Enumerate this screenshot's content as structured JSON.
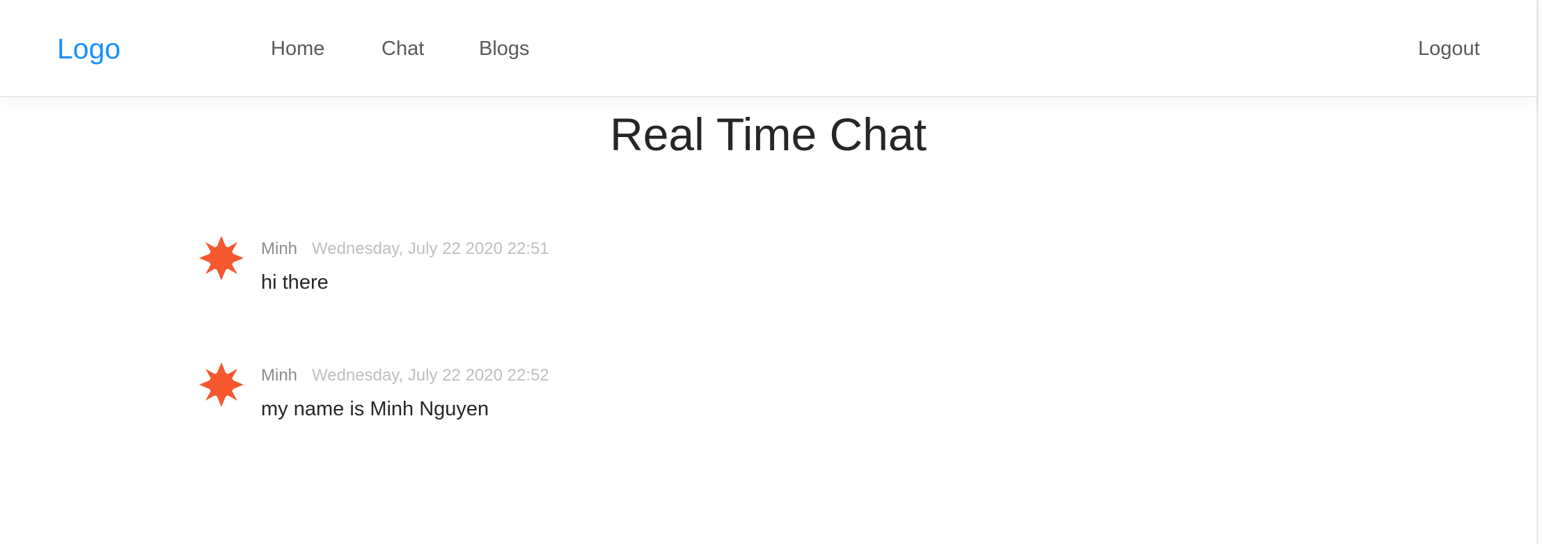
{
  "header": {
    "logo": "Logo",
    "nav": {
      "home": "Home",
      "chat": "Chat",
      "blogs": "Blogs"
    },
    "logout": "Logout"
  },
  "main": {
    "title": "Real Time Chat",
    "messages": [
      {
        "author": "Minh",
        "datetime": "Wednesday, July 22 2020 22:51",
        "content": "hi there",
        "avatar_icon": "orange-sun-avatar-icon"
      },
      {
        "author": "Minh",
        "datetime": "Wednesday, July 22 2020 22:52",
        "content": "my name is Minh Nguyen",
        "avatar_icon": "orange-sun-avatar-icon"
      }
    ]
  },
  "colors": {
    "brand": "#1890ff",
    "avatar": "#f5582e",
    "text": "#262626",
    "muted": "#8c8c8c",
    "timestamp": "#bfbfbf"
  }
}
